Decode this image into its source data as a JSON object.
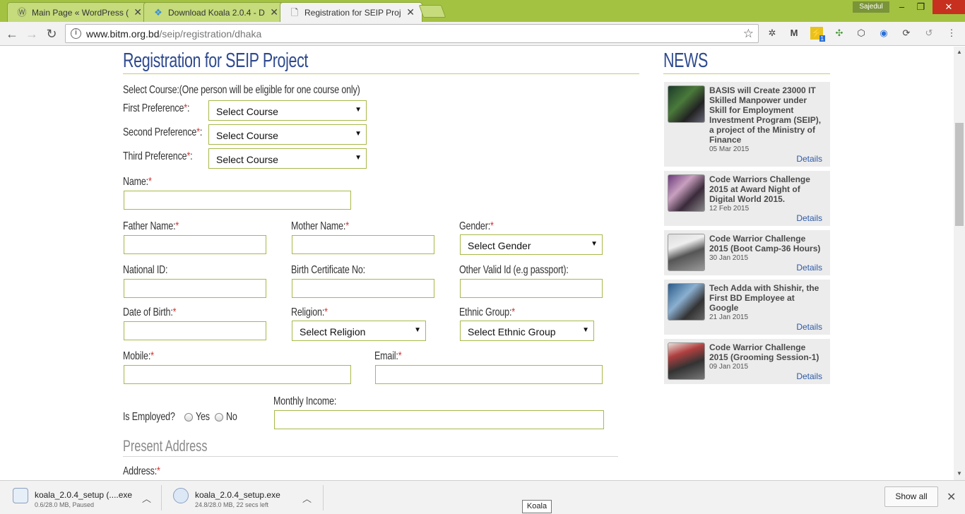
{
  "browser": {
    "tabs": [
      {
        "label": "Main Page « WordPress (",
        "icon": "wordpress-icon"
      },
      {
        "label": "Download Koala 2.0.4 - D",
        "icon": "koala-icon"
      },
      {
        "label": "Registration for SEIP Proj",
        "icon": "page-icon",
        "active": true
      }
    ],
    "user": "Sajedul",
    "url_host": "www.bitm.org.bd",
    "url_path": "/seip/registration/dhaka",
    "ext_badge": "1"
  },
  "form": {
    "title": "Registration for SEIP Project",
    "course_note": "Select Course:(One person will be eligible for one course only)",
    "first_pref": "First Preference",
    "second_pref": "Second Preference",
    "third_pref": "Third Preference",
    "course_placeholder": "Select Course",
    "name": "Name:",
    "father": "Father Name:",
    "mother": "Mother Name:",
    "gender": "Gender:",
    "gender_placeholder": "Select Gender",
    "nid": "National ID:",
    "birth_cert": "Birth Certificate No:",
    "other_id": "Other Valid Id (e.g passport):",
    "dob": "Date of Birth:",
    "religion": "Religion:",
    "religion_placeholder": "Select Religion",
    "ethnic": "Ethnic Group:",
    "ethnic_placeholder": "Select Ethnic Group",
    "mobile": "Mobile:",
    "email": "Email:",
    "monthly_income": "Monthly Income:",
    "employed": "Is Employed?",
    "yes": "Yes",
    "no": "No",
    "present_address": "Present Address",
    "address": "Address:",
    "required_mark": "*"
  },
  "news": {
    "heading": "NEWS",
    "details_label": "Details",
    "items": [
      {
        "title": "BASIS will Create 23000 IT Skilled Manpower under Skill for Employment Investment Program (SEIP), a project of the Ministry of Finance",
        "date": "05 Mar 2015"
      },
      {
        "title": "Code Warriors Challenge 2015 at Award Night of Digital World 2015.",
        "date": "12 Feb 2015"
      },
      {
        "title": "Code Warrior Challenge 2015 (Boot Camp-36 Hours)",
        "date": "30 Jan 2015"
      },
      {
        "title": "Tech Adda with Shishir, the First BD Employee at Google",
        "date": "21 Jan 2015"
      },
      {
        "title": "Code Warrior Challenge 2015 (Grooming Session-1)",
        "date": "09 Jan 2015"
      }
    ]
  },
  "downloads": {
    "items": [
      {
        "name": "koala_2.0.4_setup (....exe",
        "status": "0.6/28.0 MB, Paused"
      },
      {
        "name": "koala_2.0.4_setup.exe",
        "status": "24.8/28.0 MB, 22 secs left"
      }
    ],
    "show_all": "Show all",
    "tooltip": "Koala"
  }
}
